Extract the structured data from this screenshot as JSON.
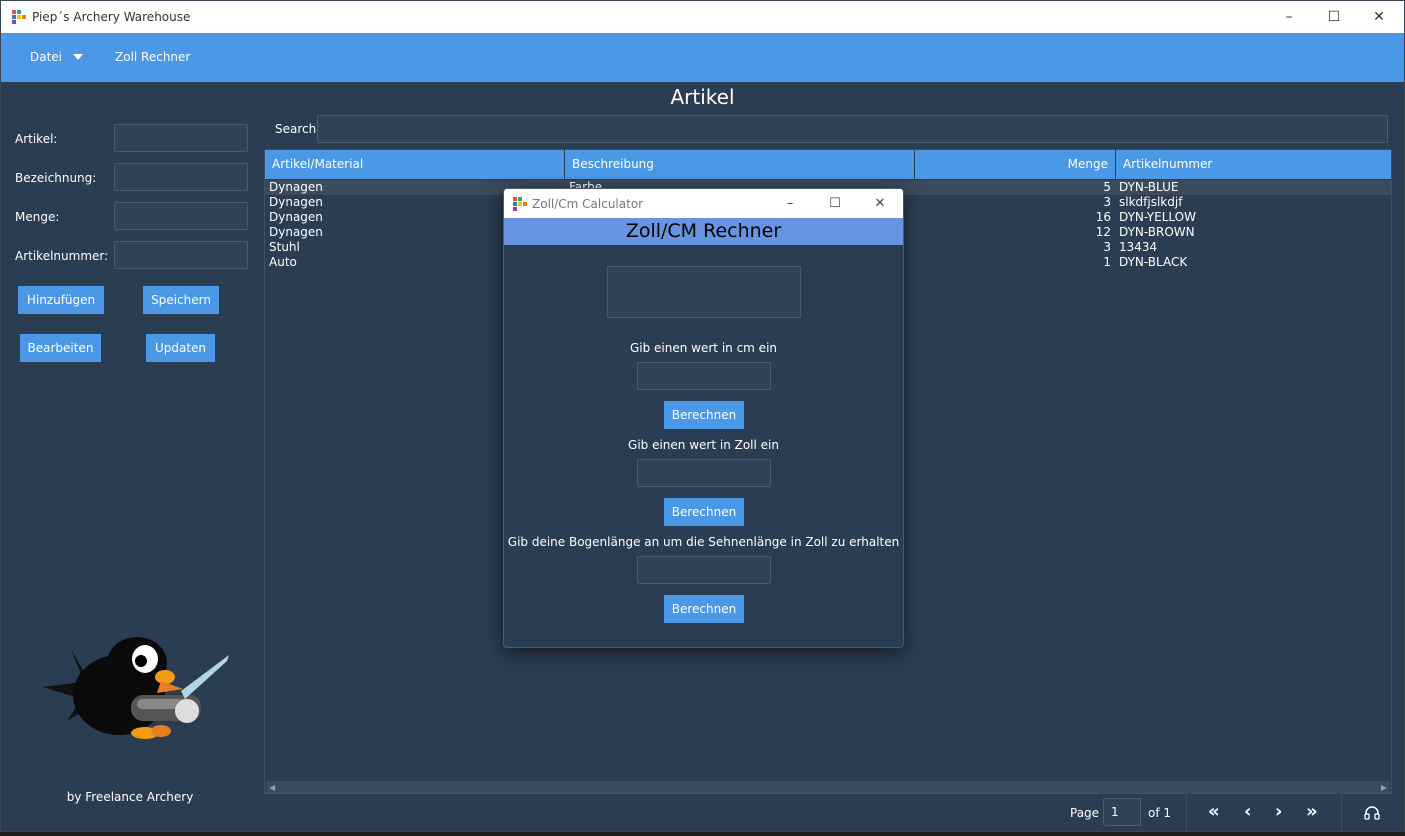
{
  "window": {
    "title": "Piep´s Archery Warehouse"
  },
  "menu": {
    "file": "Datei",
    "converter": "Zoll Rechner"
  },
  "page_title": "Artikel",
  "form": {
    "artikel_label": "Artikel:",
    "bezeichnung_label": "Bezeichnung:",
    "menge_label": "Menge:",
    "artikelnummer_label": "Artikelnummer:",
    "add_button": "Hinzufügen",
    "save_button": "Speichern",
    "edit_button": "Bearbeiten",
    "update_button": "Updaten"
  },
  "search": {
    "label": "Search",
    "value": ""
  },
  "table": {
    "columns": [
      "Artikel/Material",
      "Beschreibung",
      "Menge",
      "Artikelnummer"
    ],
    "rows": [
      {
        "material": "Dynagen",
        "beschreibung": "Farbe",
        "menge": "5",
        "nummer": "DYN-BLUE"
      },
      {
        "material": "Dynagen",
        "beschreibung": "",
        "menge": "3",
        "nummer": "slkdfjslkdjf"
      },
      {
        "material": "Dynagen",
        "beschreibung": "",
        "menge": "16",
        "nummer": "DYN-YELLOW"
      },
      {
        "material": "Dynagen",
        "beschreibung": "",
        "menge": "12",
        "nummer": "DYN-BROWN"
      },
      {
        "material": "Stuhl",
        "beschreibung": "",
        "menge": "3",
        "nummer": "13434"
      },
      {
        "material": "Auto",
        "beschreibung": "",
        "menge": "1",
        "nummer": "DYN-BLACK"
      }
    ]
  },
  "credit": "by Freelance Archery",
  "pager": {
    "page_label": "Page",
    "page_value": "1",
    "of_label": "of 1",
    "first": "«",
    "prev": "‹",
    "next": "›",
    "last": "»"
  },
  "dialog": {
    "title": "Zoll/Cm Calculator",
    "heading": "Zoll/CM Rechner",
    "cm_prompt": "Gib einen wert in cm ein",
    "zoll_prompt": "Gib einen wert in Zoll ein",
    "bow_prompt": "Gib deine Bogenlänge an um die Sehnenlänge in Zoll zu erhalten",
    "calc_button": "Berechnen"
  },
  "colors": {
    "accent": "#4a98e6",
    "background": "#2b3d52",
    "dialog_header": "#6794e0"
  },
  "icons": {
    "app": "app-logo-icon",
    "mascot": "penguin-mascot-icon",
    "tools": "headset-icon"
  }
}
